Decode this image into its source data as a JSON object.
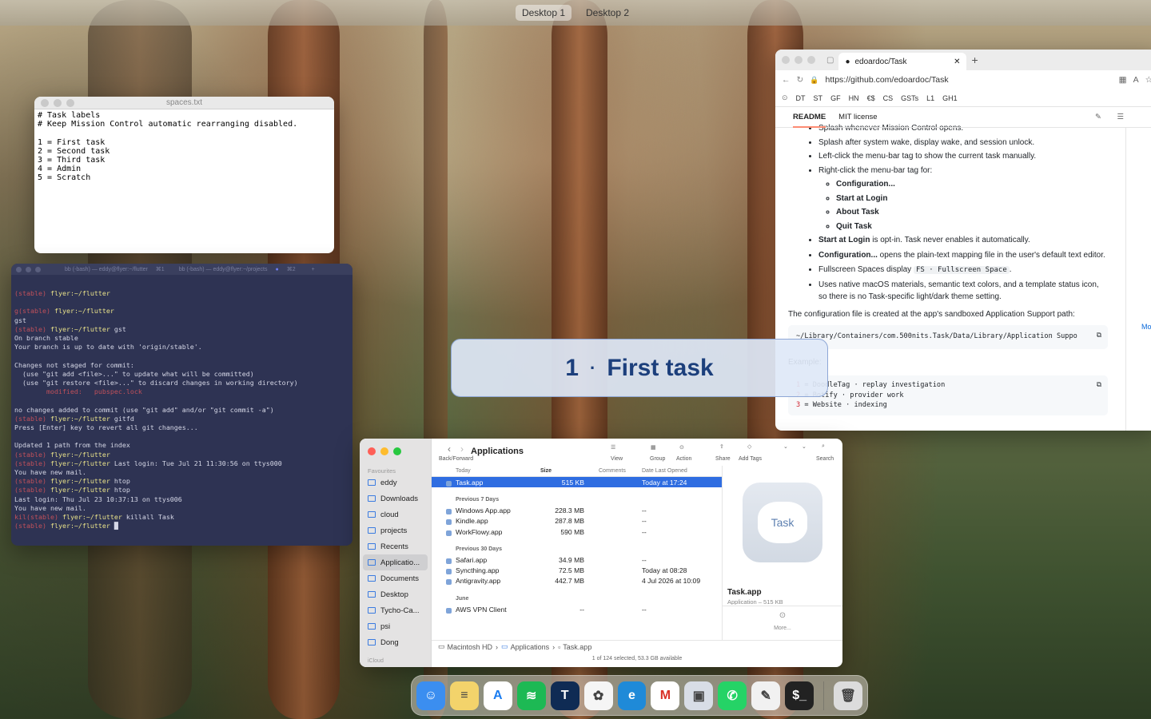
{
  "mission_control": {
    "desktops": [
      "Desktop 1",
      "Desktop 2"
    ]
  },
  "text_editor": {
    "title": "spaces.txt",
    "content": "# Task labels\n# Keep Mission Control automatic rearranging disabled.\n\n1 = First task\n2 = Second task\n3 = Third task\n4 = Admin\n5 = Scratch"
  },
  "terminal": {
    "tab1": "bb (-bash) — eddy@flyer:~/flutter",
    "tab1_shortcut": "⌘1",
    "tab2": "bb (-bash) — eddy@flyer:~/projects",
    "tab2_shortcut": "⌘2",
    "lines": [
      {
        "pre": "(stable)",
        "host": " flyer:~/flutter",
        "cmd": ""
      },
      {
        "text": ""
      },
      {
        "pre": "g(stable)",
        "host": " flyer:~/flutter",
        "cmd": ""
      },
      {
        "text": "gst"
      },
      {
        "pre": "(stable)",
        "host": " flyer:~/flutter",
        "cmd": " gst"
      },
      {
        "text": "On branch stable"
      },
      {
        "text": "Your branch is up to date with 'origin/stable'."
      },
      {
        "text": ""
      },
      {
        "text": "Changes not staged for commit:"
      },
      {
        "text": "  (use \"git add <file>...\" to update what will be committed)"
      },
      {
        "text": "  (use \"git restore <file>...\" to discard changes in working directory)"
      },
      {
        "mod": "        modified:   pubspec.lock"
      },
      {
        "text": ""
      },
      {
        "text": "no changes added to commit (use \"git add\" and/or \"git commit -a\")"
      },
      {
        "pre": "(stable)",
        "host": " flyer:~/flutter",
        "cmd": " gitfd"
      },
      {
        "text": "Press [Enter] key to revert all git changes..."
      },
      {
        "text": ""
      },
      {
        "text": "Updated 1 path from the index"
      },
      {
        "pre": "(stable)",
        "host": " flyer:~/flutter",
        "cmd": ""
      },
      {
        "pre": "(stable)",
        "host": " flyer:~/flutter",
        "cmd": " Last login: Tue Jul 21 11:30:56 on ttys000"
      },
      {
        "text": "You have new mail."
      },
      {
        "pre": "(stable)",
        "host": " flyer:~/flutter",
        "cmd": " htop"
      },
      {
        "pre": "(stable)",
        "host": " flyer:~/flutter",
        "cmd": " htop"
      },
      {
        "text": "Last login: Thu Jul 23 10:37:13 on ttys006"
      },
      {
        "text": "You have new mail."
      },
      {
        "pre": "kil(stable)",
        "host": " flyer:~/flutter",
        "cmd": " killall Task"
      },
      {
        "pre": "(stable)",
        "host": " flyer:~/flutter",
        "cmd": " █"
      }
    ]
  },
  "browser": {
    "tab_title": "edoardoc/Task",
    "url": "https://github.com/edoardoc/Task",
    "bookmarks": [
      "DT",
      "ST",
      "GF",
      "HN",
      "€$",
      "CS",
      "GSTs",
      "L1",
      "GH1"
    ],
    "readme_tabs": [
      "README",
      "MIT license"
    ],
    "bullets": [
      {
        "text": "Splash whenever Mission Control opens."
      },
      {
        "text": "Splash after system wake, display wake, and session unlock."
      },
      {
        "text": "Left-click the menu-bar tag to show the current task manually."
      },
      {
        "text": "Right-click the menu-bar tag for:"
      }
    ],
    "sub_bullets": [
      "Configuration...",
      "Start at Login",
      "About Task",
      "Quit Task"
    ],
    "bullet_login_bold": "Start at Login",
    "bullet_login_rest": " is opt-in. Task never enables it automatically.",
    "bullet_config_bold": "Configuration...",
    "bullet_config_rest": " opens the plain-text mapping file in the user's default text editor.",
    "bullet_fs_pre": "Fullscreen Spaces display ",
    "bullet_fs_code": "FS · Fullscreen Space",
    "bullet_fs_post": ".",
    "bullet_native": "Uses native macOS materials, semantic text colors, and a template status icon, so there is no Task-specific light/dark theme setting.",
    "config_para": "The configuration file is created at the app's sandboxed Application Support path:",
    "config_path": "~/Library/Containers/com.500nits.Task/Data/Library/Application Suppo",
    "example_label": "Example:",
    "example_lines": [
      {
        "n": "1",
        "t": " = DoodleTag · replay investigation"
      },
      {
        "n": "2",
        "t": " = Botify · provider work"
      },
      {
        "n": "3",
        "t": " = Website · indexing"
      }
    ],
    "side_more": "Mo"
  },
  "finder": {
    "title": "Applications",
    "toolbar": {
      "back_forward": "Back/Forward",
      "view": "View",
      "group": "Group",
      "action": "Action",
      "share": "Share",
      "add_tags": "Add Tags",
      "search": "Search"
    },
    "sidebar_header": "Favourites",
    "sidebar": [
      "eddy",
      "Downloads",
      "cloud",
      "projects",
      "Recents",
      "Applicatio...",
      "Documents",
      "Desktop",
      "Tycho-Ca...",
      "psi",
      "Dong"
    ],
    "sidebar_footer": "iCloud",
    "columns": {
      "name": "Today",
      "size": "Size",
      "comments": "Comments",
      "date": "Date Last Opened"
    },
    "groups": [
      {
        "label": "",
        "rows": [
          {
            "name": "Task.app",
            "size": "515 KB",
            "date": "Today at 17:24",
            "selected": true
          }
        ]
      },
      {
        "label": "Previous 7 Days",
        "rows": [
          {
            "name": "Windows App.app",
            "size": "228.3 MB",
            "date": "--"
          },
          {
            "name": "Kindle.app",
            "size": "287.8 MB",
            "date": "--"
          },
          {
            "name": "WorkFlowy.app",
            "size": "590 MB",
            "date": "--"
          }
        ]
      },
      {
        "label": "Previous 30 Days",
        "rows": [
          {
            "name": "Safari.app",
            "size": "34.9 MB",
            "date": "--"
          },
          {
            "name": "Syncthing.app",
            "size": "72.5 MB",
            "date": "Today at 08:28"
          },
          {
            "name": "Antigravity.app",
            "size": "442.7 MB",
            "date": "4 Jul 2026 at 10:09"
          }
        ]
      },
      {
        "label": "June",
        "rows": [
          {
            "name": "AWS VPN Client",
            "size": "--",
            "date": "--"
          }
        ]
      }
    ],
    "preview": {
      "icon_label": "Task",
      "name": "Task.app",
      "kind": "Application – 515 KB",
      "more": "More..."
    },
    "path": [
      "Macintosh HD",
      "Applications",
      "Task.app"
    ],
    "status": "1 of 124 selected, 53.3 GB available"
  },
  "splash": {
    "number": "1",
    "sep": "·",
    "label": "First task"
  },
  "dock": {
    "apps": [
      {
        "name": "finder-icon",
        "color": "#3b8ef0",
        "glyph": "☺"
      },
      {
        "name": "notes-icon",
        "color": "#f3d36b",
        "glyph": "≡"
      },
      {
        "name": "app-store-icon",
        "color": "#ffffff",
        "glyph": "A"
      },
      {
        "name": "spotify-icon",
        "color": "#1db954",
        "glyph": "≋"
      },
      {
        "name": "typora-icon",
        "color": "#0f2b54",
        "glyph": "T"
      },
      {
        "name": "photos-icon",
        "color": "#f5f5f5",
        "glyph": "✿"
      },
      {
        "name": "edge-icon",
        "color": "#1f8ad8",
        "glyph": "e"
      },
      {
        "name": "gmail-icon",
        "color": "#ffffff",
        "glyph": "M"
      },
      {
        "name": "preview-icon",
        "color": "#d8dde6",
        "glyph": "▣"
      },
      {
        "name": "whatsapp-icon",
        "color": "#25d366",
        "glyph": "✆"
      },
      {
        "name": "textedit-icon",
        "color": "#f1f1f1",
        "glyph": "✎"
      },
      {
        "name": "terminal-icon",
        "color": "#222222",
        "glyph": "$_"
      },
      {
        "name": "trash-icon",
        "color": "#dcdcdc",
        "glyph": "🗑"
      }
    ]
  }
}
